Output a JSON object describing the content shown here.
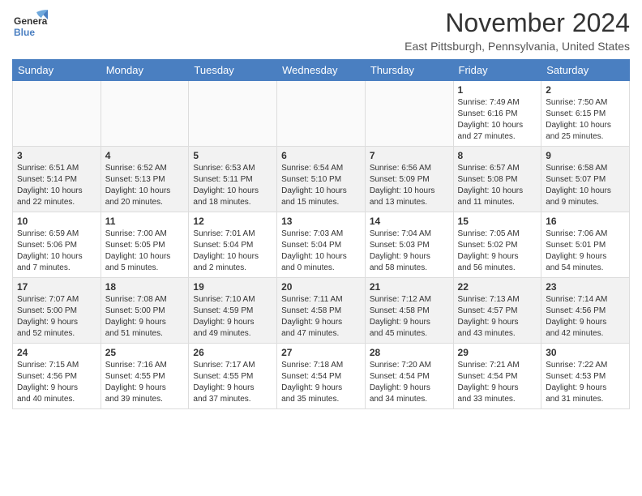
{
  "logo": {
    "general": "General",
    "blue": "Blue"
  },
  "title": "November 2024",
  "location": "East Pittsburgh, Pennsylvania, United States",
  "days_header": [
    "Sunday",
    "Monday",
    "Tuesday",
    "Wednesday",
    "Thursday",
    "Friday",
    "Saturday"
  ],
  "weeks": [
    [
      {
        "day": "",
        "info": ""
      },
      {
        "day": "",
        "info": ""
      },
      {
        "day": "",
        "info": ""
      },
      {
        "day": "",
        "info": ""
      },
      {
        "day": "",
        "info": ""
      },
      {
        "day": "1",
        "info": "Sunrise: 7:49 AM\nSunset: 6:16 PM\nDaylight: 10 hours\nand 27 minutes."
      },
      {
        "day": "2",
        "info": "Sunrise: 7:50 AM\nSunset: 6:15 PM\nDaylight: 10 hours\nand 25 minutes."
      }
    ],
    [
      {
        "day": "3",
        "info": "Sunrise: 6:51 AM\nSunset: 5:14 PM\nDaylight: 10 hours\nand 22 minutes."
      },
      {
        "day": "4",
        "info": "Sunrise: 6:52 AM\nSunset: 5:13 PM\nDaylight: 10 hours\nand 20 minutes."
      },
      {
        "day": "5",
        "info": "Sunrise: 6:53 AM\nSunset: 5:11 PM\nDaylight: 10 hours\nand 18 minutes."
      },
      {
        "day": "6",
        "info": "Sunrise: 6:54 AM\nSunset: 5:10 PM\nDaylight: 10 hours\nand 15 minutes."
      },
      {
        "day": "7",
        "info": "Sunrise: 6:56 AM\nSunset: 5:09 PM\nDaylight: 10 hours\nand 13 minutes."
      },
      {
        "day": "8",
        "info": "Sunrise: 6:57 AM\nSunset: 5:08 PM\nDaylight: 10 hours\nand 11 minutes."
      },
      {
        "day": "9",
        "info": "Sunrise: 6:58 AM\nSunset: 5:07 PM\nDaylight: 10 hours\nand 9 minutes."
      }
    ],
    [
      {
        "day": "10",
        "info": "Sunrise: 6:59 AM\nSunset: 5:06 PM\nDaylight: 10 hours\nand 7 minutes."
      },
      {
        "day": "11",
        "info": "Sunrise: 7:00 AM\nSunset: 5:05 PM\nDaylight: 10 hours\nand 5 minutes."
      },
      {
        "day": "12",
        "info": "Sunrise: 7:01 AM\nSunset: 5:04 PM\nDaylight: 10 hours\nand 2 minutes."
      },
      {
        "day": "13",
        "info": "Sunrise: 7:03 AM\nSunset: 5:04 PM\nDaylight: 10 hours\nand 0 minutes."
      },
      {
        "day": "14",
        "info": "Sunrise: 7:04 AM\nSunset: 5:03 PM\nDaylight: 9 hours\nand 58 minutes."
      },
      {
        "day": "15",
        "info": "Sunrise: 7:05 AM\nSunset: 5:02 PM\nDaylight: 9 hours\nand 56 minutes."
      },
      {
        "day": "16",
        "info": "Sunrise: 7:06 AM\nSunset: 5:01 PM\nDaylight: 9 hours\nand 54 minutes."
      }
    ],
    [
      {
        "day": "17",
        "info": "Sunrise: 7:07 AM\nSunset: 5:00 PM\nDaylight: 9 hours\nand 52 minutes."
      },
      {
        "day": "18",
        "info": "Sunrise: 7:08 AM\nSunset: 5:00 PM\nDaylight: 9 hours\nand 51 minutes."
      },
      {
        "day": "19",
        "info": "Sunrise: 7:10 AM\nSunset: 4:59 PM\nDaylight: 9 hours\nand 49 minutes."
      },
      {
        "day": "20",
        "info": "Sunrise: 7:11 AM\nSunset: 4:58 PM\nDaylight: 9 hours\nand 47 minutes."
      },
      {
        "day": "21",
        "info": "Sunrise: 7:12 AM\nSunset: 4:58 PM\nDaylight: 9 hours\nand 45 minutes."
      },
      {
        "day": "22",
        "info": "Sunrise: 7:13 AM\nSunset: 4:57 PM\nDaylight: 9 hours\nand 43 minutes."
      },
      {
        "day": "23",
        "info": "Sunrise: 7:14 AM\nSunset: 4:56 PM\nDaylight: 9 hours\nand 42 minutes."
      }
    ],
    [
      {
        "day": "24",
        "info": "Sunrise: 7:15 AM\nSunset: 4:56 PM\nDaylight: 9 hours\nand 40 minutes."
      },
      {
        "day": "25",
        "info": "Sunrise: 7:16 AM\nSunset: 4:55 PM\nDaylight: 9 hours\nand 39 minutes."
      },
      {
        "day": "26",
        "info": "Sunrise: 7:17 AM\nSunset: 4:55 PM\nDaylight: 9 hours\nand 37 minutes."
      },
      {
        "day": "27",
        "info": "Sunrise: 7:18 AM\nSunset: 4:54 PM\nDaylight: 9 hours\nand 35 minutes."
      },
      {
        "day": "28",
        "info": "Sunrise: 7:20 AM\nSunset: 4:54 PM\nDaylight: 9 hours\nand 34 minutes."
      },
      {
        "day": "29",
        "info": "Sunrise: 7:21 AM\nSunset: 4:54 PM\nDaylight: 9 hours\nand 33 minutes."
      },
      {
        "day": "30",
        "info": "Sunrise: 7:22 AM\nSunset: 4:53 PM\nDaylight: 9 hours\nand 31 minutes."
      }
    ]
  ]
}
